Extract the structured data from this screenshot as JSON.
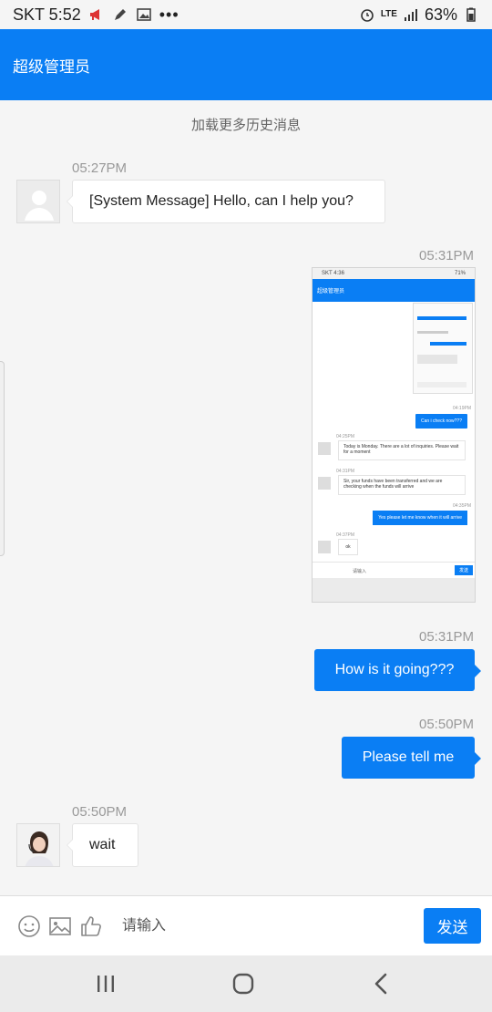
{
  "status": {
    "carrier_time": "SKT 5:52",
    "battery_text": "63%"
  },
  "header": {
    "title": "超级管理员"
  },
  "chat": {
    "load_more": "加载更多历史消息",
    "messages": [
      {
        "time": "05:27PM",
        "text": "[System Message] Hello, can I help you?"
      },
      {
        "time": "05:31PM"
      },
      {
        "time": "05:31PM",
        "text": "How is it going???"
      },
      {
        "time": "05:50PM",
        "text": "Please tell me"
      },
      {
        "time": "05:50PM",
        "text": "wait"
      }
    ],
    "screenshot": {
      "status_left": "SKT 4:36",
      "status_right": "71%",
      "title": "超级管理员",
      "times": [
        "04:19PM",
        "04:25PM",
        "04:31PM",
        "04:35PM",
        "04:37PM"
      ],
      "out1": "Can i check now???",
      "in1": "Today is Monday. There are a lot of inquiries. Please wait for a moment",
      "in2": "Sir, your funds have been transferred and we are checking when the funds will arrive",
      "out2": "Yes please let me know when it will arrive",
      "in3": "ok",
      "input_placeholder": "请输入",
      "send": "发送"
    }
  },
  "inputbar": {
    "placeholder": "请输入",
    "send_label": "发送"
  },
  "colors": {
    "accent": "#0a7ef4",
    "background": "#f5f5f5"
  }
}
